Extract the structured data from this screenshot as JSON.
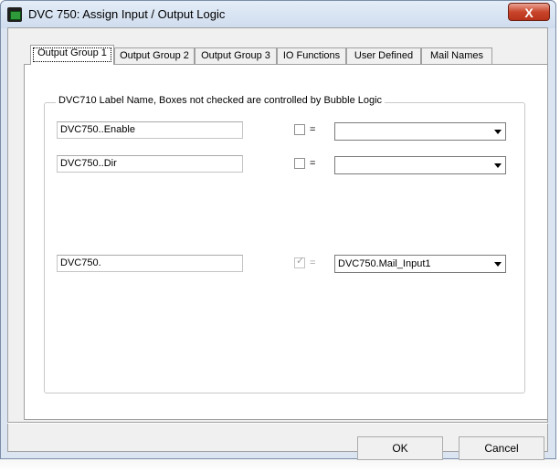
{
  "window": {
    "title": "DVC 750: Assign Input / Output Logic"
  },
  "titlebar": {
    "close_glyph": "X",
    "app_icon": "dvc-app-icon"
  },
  "tabs": [
    {
      "label": "Output Group 1",
      "active": true
    },
    {
      "label": "Output Group 2",
      "active": false
    },
    {
      "label": "Output Group 3",
      "active": false
    },
    {
      "label": "IO Functions",
      "active": false
    },
    {
      "label": "User Defined",
      "active": false
    },
    {
      "label": "Mail Names",
      "active": false
    }
  ],
  "group": {
    "title": "DVC710 Label Name, Boxes not checked are controlled by Bubble Logic"
  },
  "rows": [
    {
      "label_value": "DVC750..Enable",
      "checked": false,
      "disabled": false,
      "equals": "=",
      "dropdown_value": ""
    },
    {
      "label_value": "DVC750..Dir",
      "checked": false,
      "disabled": false,
      "equals": "=",
      "dropdown_value": ""
    },
    {
      "label_value": "DVC750.",
      "checked": true,
      "disabled": true,
      "equals": "=",
      "dropdown_value": "DVC750.Mail_Input1"
    }
  ],
  "buttons": {
    "ok": "OK",
    "cancel": "Cancel"
  },
  "colors": {
    "titlebar": "#dbe5f1",
    "close_button": "#c9462c",
    "panel": "#ffffff",
    "dialog_bg": "#f0f0f0"
  }
}
